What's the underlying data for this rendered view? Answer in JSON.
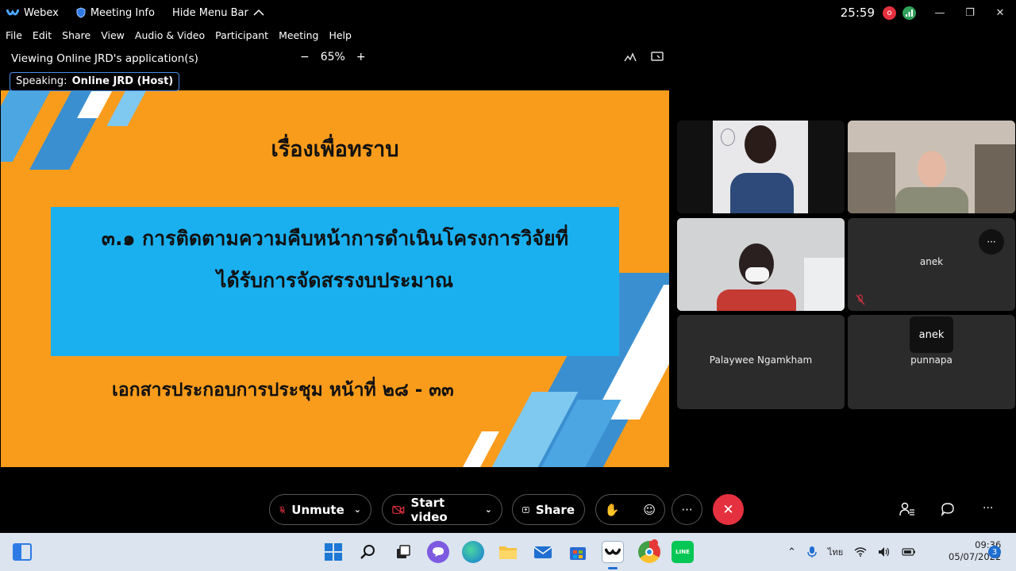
{
  "titlebar": {
    "app_name": "Webex",
    "meeting_info": "Meeting Info",
    "hide_menu": "Hide Menu Bar",
    "timer": "25:59",
    "rec_icon": "o"
  },
  "menu": {
    "items": [
      "File",
      "Edit",
      "Share",
      "View",
      "Audio & Video",
      "Participant",
      "Meeting",
      "Help"
    ]
  },
  "view": {
    "title": "Viewing Online JRD's application(s)",
    "zoom_minus": "−",
    "zoom_level": "65%",
    "zoom_plus": "+"
  },
  "speaking": {
    "label": "Speaking:",
    "name": "Online JRD (Host)"
  },
  "slide": {
    "heading": "เรื่องเพื่อทราบ",
    "box_line1": "๓.๑ การติดตามความคืบหน้าการดำเนินโครงการวิจัยที่",
    "box_line2": "ได้รับการจัดสรรงบประมาณ",
    "footer": "เอกสารประกอบการประชุม หน้าที่ ๒๘ - ๓๓"
  },
  "participants": [
    {
      "name": "",
      "video": true
    },
    {
      "name": "",
      "video": true
    },
    {
      "name": "",
      "video": true
    },
    {
      "name": "anek",
      "video": false,
      "muted": true
    },
    {
      "name": "Palaywee Ngamkham",
      "video": false
    },
    {
      "name": "punnapa",
      "video": false
    }
  ],
  "tooltip": "anek",
  "controls": {
    "unmute": "Unmute",
    "start_video": "Start video",
    "share": "Share",
    "more": "···",
    "end": "✕"
  },
  "taskbar": {
    "time": "09:36",
    "date": "05/07/2022",
    "lang": "ไทย",
    "notif_count": "3",
    "line_label": "LINE"
  },
  "colors": {
    "slide_orange": "#f99c1c",
    "slide_blue": "#1ab0f0",
    "end_red": "#e5313f",
    "accent_blue": "#4a8fe7"
  }
}
